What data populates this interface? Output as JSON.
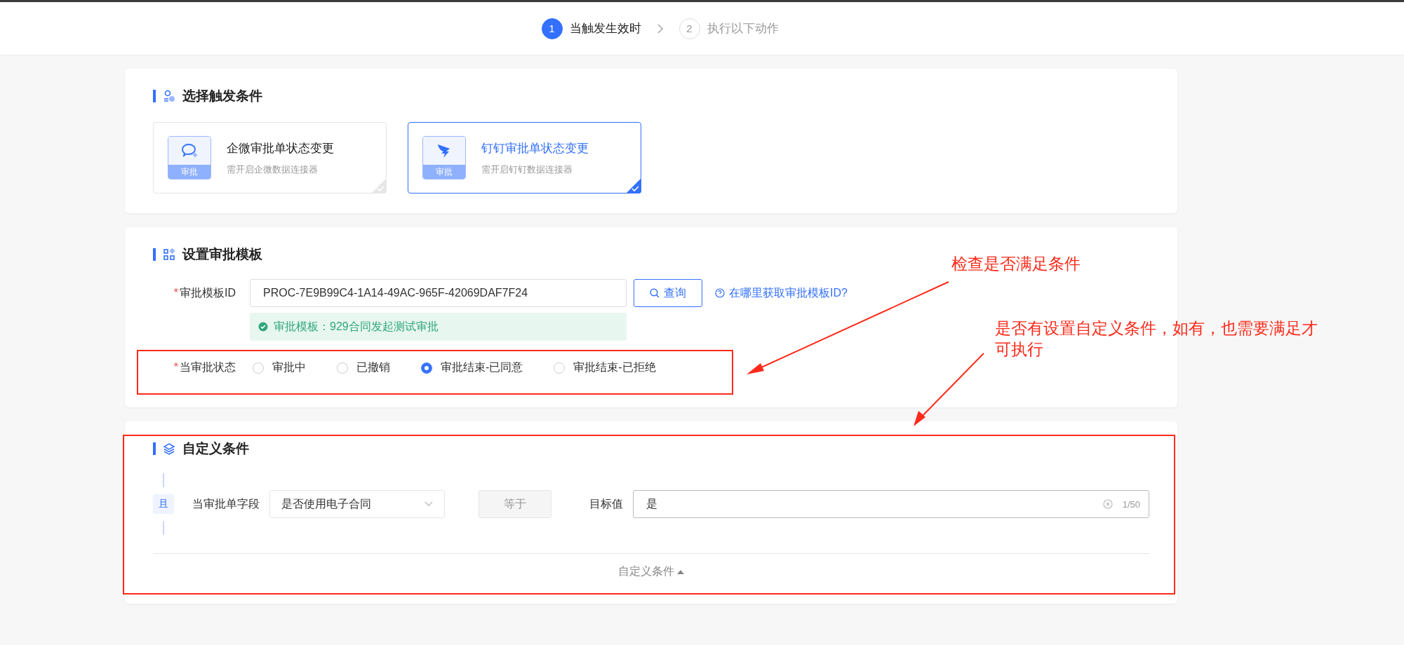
{
  "steps": [
    {
      "number": "1",
      "label": "当触发生效时",
      "selected": true
    },
    {
      "number": "2",
      "label": "执行以下动作",
      "selected": false
    }
  ],
  "trigger_section": {
    "title": "选择触发条件",
    "options": [
      {
        "kind": "wecom",
        "title": "企微审批单状态变更",
        "subtitle": "需开启企微数据连接器",
        "badge": "审批",
        "selected": false
      },
      {
        "kind": "dingtalk",
        "title": "钉钉审批单状态变更",
        "subtitle": "需开启钉钉数据连接器",
        "badge": "审批",
        "selected": true
      }
    ]
  },
  "template_section": {
    "title": "设置审批模板",
    "required_mark": "*",
    "id_label": "审批模板ID",
    "id_value": "PROC-7E9B99C4-1A14-49AC-965F-42069DAF7F24",
    "query_button": "查询",
    "help_link": "在哪里获取审批模板ID?",
    "success_message": "审批模板：929合同发起测试审批",
    "status_label": "当审批状态",
    "statuses": [
      {
        "label": "审批中",
        "selected": false
      },
      {
        "label": "已撤销",
        "selected": false
      },
      {
        "label": "审批结束-已同意",
        "selected": true
      },
      {
        "label": "审批结束-已拒绝",
        "selected": false
      }
    ]
  },
  "custom_section": {
    "title": "自定义条件",
    "conditions": [
      {
        "logic": "且",
        "field_label": "当审批单字段",
        "field_value": "是否使用电子合同",
        "operator": "等于",
        "target_label": "目标值",
        "target_value": "是",
        "counter": "1/50"
      }
    ],
    "toggle": "自定义条件",
    "expanded": true
  },
  "annotations": [
    {
      "text": "检查是否满足条件"
    },
    {
      "text": "是否有设置自定义条件，如有，也需要满足才可执行"
    }
  ]
}
